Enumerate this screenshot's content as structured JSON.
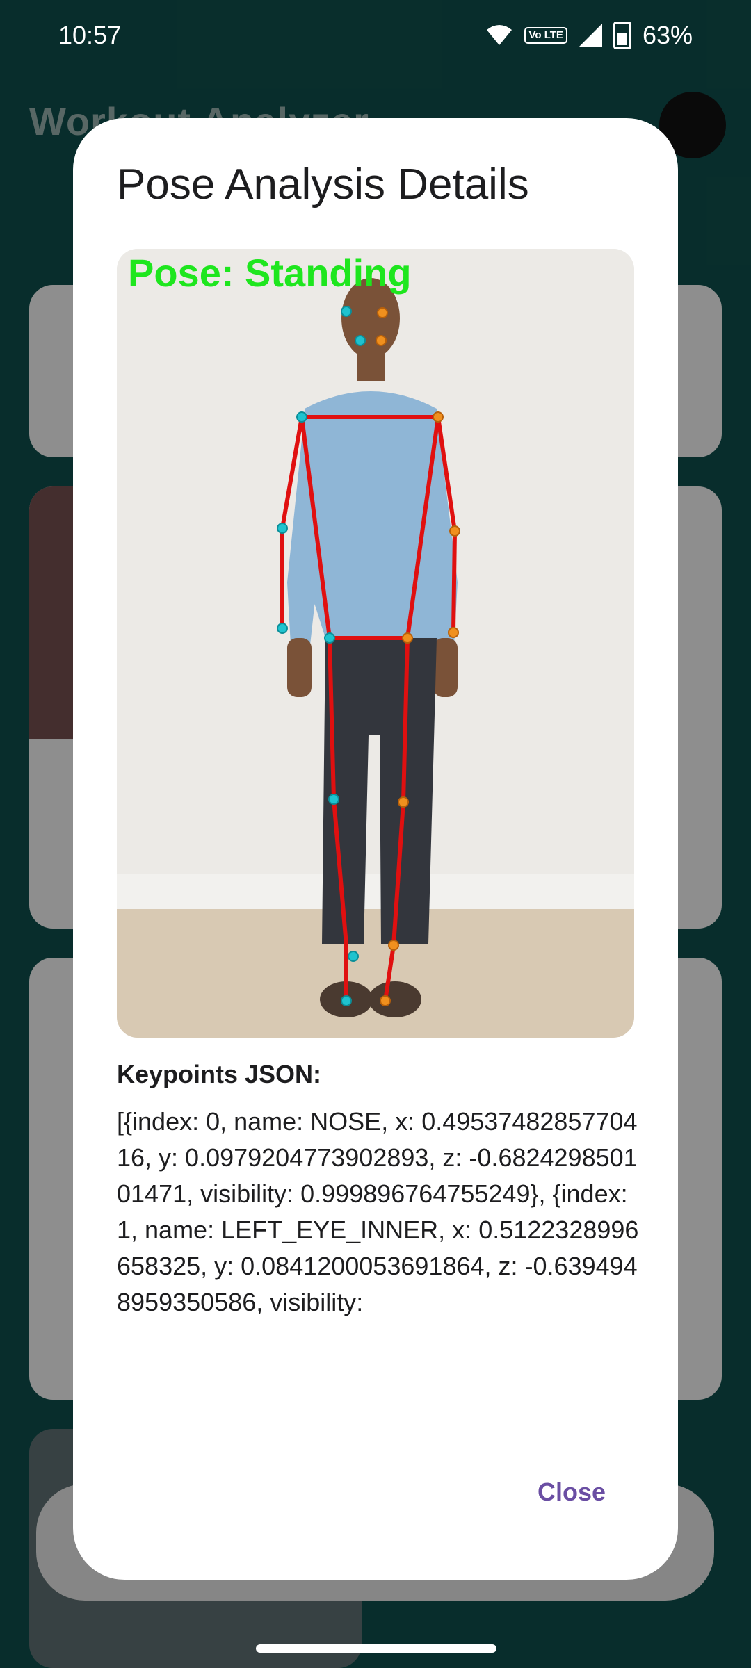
{
  "status_bar": {
    "time": "10:57",
    "battery": "63%",
    "lte": "Vo LTE"
  },
  "app": {
    "title": "Workout Analyzer"
  },
  "dialog": {
    "title": "Pose Analysis Details",
    "image_label": "Pose: Standing",
    "keypoints_heading": "Keypoints JSON:",
    "keypoints_text": "[{index: 0, name: NOSE, x: 0.4953748285770416, y: 0.0979204773902893, z: -0.682429850101471, visibility: 0.999896764755249}, {index: 1, name: LEFT_EYE_INNER, x: 0.5122328996658325, y: 0.0841200053691864, z: -0.6394948959350586, visibility:",
    "close_label": "Close"
  },
  "colors": {
    "skeleton": "#e01010",
    "left_joint": "#1fc3cf",
    "right_joint": "#f0901e",
    "accent": "#6a4ea3"
  }
}
